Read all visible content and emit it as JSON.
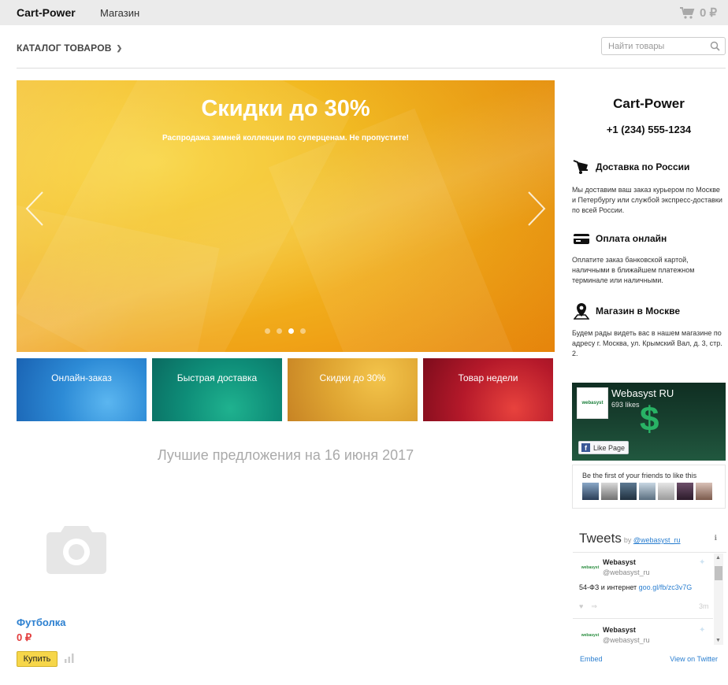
{
  "topbar": {
    "brand": "Cart-Power",
    "shop_link": "Магазин",
    "cart_total": "0 ₽"
  },
  "nav": {
    "catalog": "КАТАЛОГ ТОВАРОВ",
    "search_placeholder": "Найти товары"
  },
  "hero": {
    "title": "Скидки до 30%",
    "subtitle": "Распродажа зимней коллекции по суперценам. Не пропустите!",
    "slides": 4,
    "active_slide": 3
  },
  "tiles": [
    {
      "label": "Онлайн-заказ"
    },
    {
      "label": "Быстрая доставка"
    },
    {
      "label": "Скидки до 30%"
    },
    {
      "label": "Товар недели"
    }
  ],
  "offers": {
    "title": "Лучшие предложения на 16 июня 2017"
  },
  "product": {
    "name": "Футболка",
    "price": "0 ₽",
    "buy_label": "Купить"
  },
  "sidebar": {
    "title": "Cart-Power",
    "phone": "+1 (234) 555-1234",
    "features": [
      {
        "title": "Доставка по России",
        "icon": "delivery-cart-icon",
        "text": "Мы доставим ваш заказ курьером по Москве и Петербургу или службой экспресс-доставки по всей России."
      },
      {
        "title": "Оплата онлайн",
        "icon": "credit-card-icon",
        "text": "Оплатите заказ банковской картой, наличными в ближайшем платежном терминале или наличными."
      },
      {
        "title": "Магазин в Москве",
        "icon": "map-pin-icon",
        "text": "Будем рады видеть вас в нашем магазине по адресу г. Москва, ул. Крымский Вал, д. 3, стр. 2."
      }
    ]
  },
  "facebook": {
    "logo": "webasyst",
    "page_name": "Webasyst RU",
    "likes": "693 likes",
    "like_button": "Like Page",
    "friends_text": "Be the first of your friends to like this"
  },
  "twitter": {
    "title": "Tweets",
    "by": "by",
    "handle": "@webasyst_ru",
    "info": "ℹ",
    "tweets": [
      {
        "name": "Webasyst",
        "handle": "@webasyst_ru",
        "text": "54-ФЗ и интернет",
        "link": "goo.gl/fb/zc3v7G",
        "time": "3m",
        "avatar": "webasyst"
      },
      {
        "name": "Webasyst",
        "handle": "@webasyst_ru",
        "avatar": "webasyst"
      }
    ],
    "embed": "Embed",
    "view_on": "View on Twitter"
  },
  "colors": {
    "accent_link": "#2b7fd0",
    "price": "#e23b3b",
    "buy_button": "#f6d64a",
    "topbar": "#ebebeb"
  }
}
